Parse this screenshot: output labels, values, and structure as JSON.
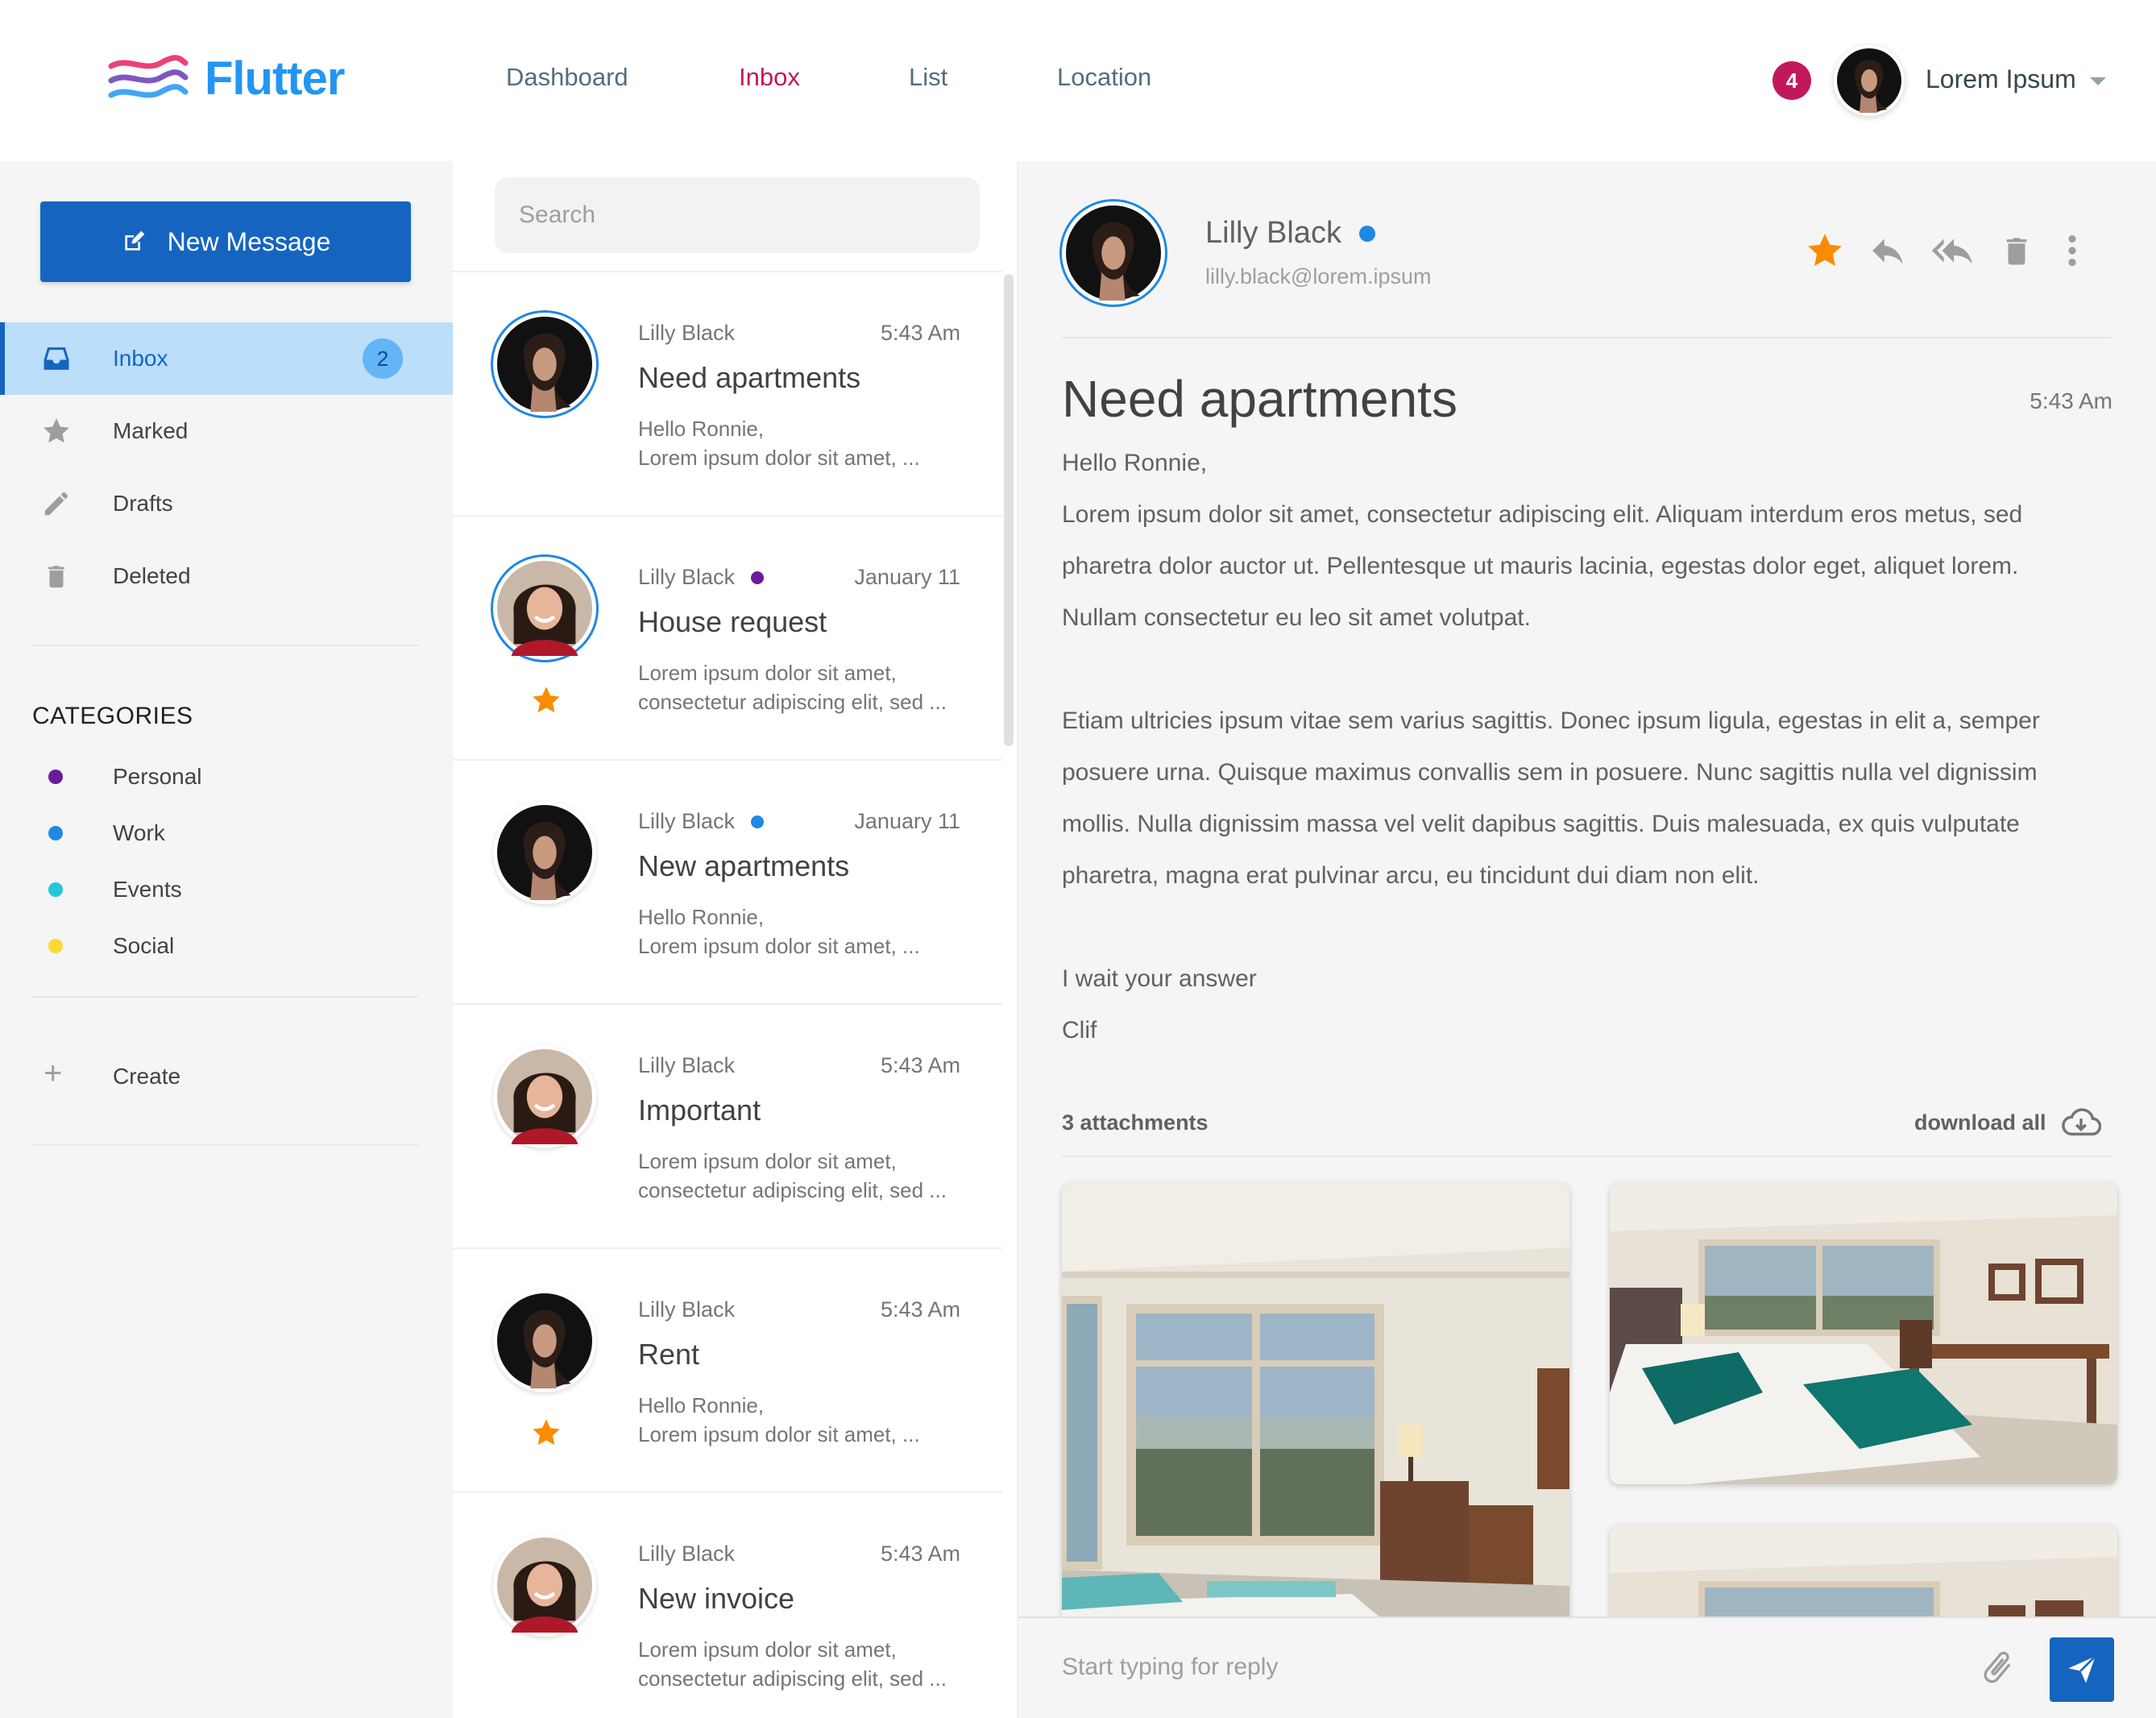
{
  "app": {
    "logo_text": "Flutter"
  },
  "nav": {
    "items": [
      {
        "label": "Dashboard"
      },
      {
        "label": "Inbox",
        "active": true
      },
      {
        "label": "List"
      },
      {
        "label": "Location"
      }
    ]
  },
  "user": {
    "notification_count": "4",
    "name": "Lorem Ipsum",
    "avatar_icon": "user-avatar-icon"
  },
  "sidebar": {
    "new_message_label": "New Message",
    "items": [
      {
        "label": "Inbox",
        "count": "2",
        "icon": "inbox-icon",
        "active": true
      },
      {
        "label": "Marked",
        "icon": "star-icon"
      },
      {
        "label": "Drafts",
        "icon": "pencil-icon"
      },
      {
        "label": "Deleted",
        "icon": "trash-icon"
      }
    ],
    "categories_heading": "CATEGORIES",
    "categories": [
      {
        "label": "Personal",
        "color": "#6a1b9a"
      },
      {
        "label": "Work",
        "color": "#1e88e5"
      },
      {
        "label": "Events",
        "color": "#26c6da"
      },
      {
        "label": "Social",
        "color": "#fdd835"
      }
    ],
    "create_label": "Create"
  },
  "search": {
    "placeholder": "Search"
  },
  "messages": [
    {
      "sender": "Lilly Black",
      "time": "5:43 Am",
      "subject": "Need apartments",
      "preview": [
        "Hello Ronnie,",
        "Lorem ipsum dolor sit amet, ..."
      ],
      "avatar": "dark",
      "ring": true,
      "starred": false,
      "dot": ""
    },
    {
      "sender": "Lilly Black",
      "time": "January 11",
      "subject": "House request",
      "preview": [
        "Lorem ipsum dolor sit amet,",
        "consectetur adipiscing elit, sed ..."
      ],
      "avatar": "smile",
      "ring": true,
      "starred": true,
      "dot": "#6a1b9a"
    },
    {
      "sender": "Lilly Black",
      "time": "January 11",
      "subject": "New apartments",
      "preview": [
        "Hello Ronnie,",
        "Lorem ipsum dolor sit amet, ..."
      ],
      "avatar": "dark",
      "ring": false,
      "starred": false,
      "dot": "#1e88e5"
    },
    {
      "sender": "Lilly Black",
      "time": "5:43 Am",
      "subject": "Important",
      "preview": [
        "Lorem ipsum dolor sit amet,",
        "consectetur adipiscing elit, sed ..."
      ],
      "avatar": "smile",
      "ring": false,
      "starred": false,
      "dot": ""
    },
    {
      "sender": "Lilly Black",
      "time": "5:43 Am",
      "subject": "Rent",
      "preview": [
        "Hello Ronnie,",
        "Lorem ipsum dolor sit amet, ..."
      ],
      "avatar": "dark",
      "ring": false,
      "starred": true,
      "dot": ""
    },
    {
      "sender": "Lilly Black",
      "time": "5:43 Am",
      "subject": "New invoice",
      "preview": [
        "Lorem ipsum dolor sit amet,",
        "consectetur adipiscing elit, sed ..."
      ],
      "avatar": "smile",
      "ring": false,
      "starred": false,
      "dot": ""
    }
  ],
  "detail": {
    "sender_name": "Lilly Black",
    "sender_status_color": "#1e88e5",
    "sender_email": "lilly.black@lorem.ipsum",
    "subject": "Need apartments",
    "time": "5:43 Am",
    "body_lines": [
      "Hello Ronnie,",
      "Lorem ipsum dolor sit amet, consectetur adipiscing elit. Aliquam interdum eros metus, sed",
      "pharetra dolor auctor ut. Pellentesque ut mauris lacinia, egestas dolor eget, aliquet lorem.",
      "Nullam consectetur eu leo sit amet volutpat.",
      "Etiam ultricies ipsum vitae sem varius sagittis. Donec ipsum ligula, egestas in elit a, semper",
      "posuere urna. Quisque maximus convallis sem in posuere. Nunc sagittis nulla vel dignissim",
      "mollis. Nulla dignissim massa vel velit dapibus sagittis. Duis malesuada, ex quis vulputate",
      "pharetra, magna erat pulvinar arcu, eu tincidunt dui diam non elit.",
      "I wait your answer",
      "Clif"
    ],
    "attachments_label": "3 attachments",
    "download_all_label": "download all",
    "reply_placeholder": "Start typing for reply"
  },
  "colors": {
    "primary": "#1565c0",
    "accent": "#c2185b",
    "star": "#fb8c00"
  }
}
